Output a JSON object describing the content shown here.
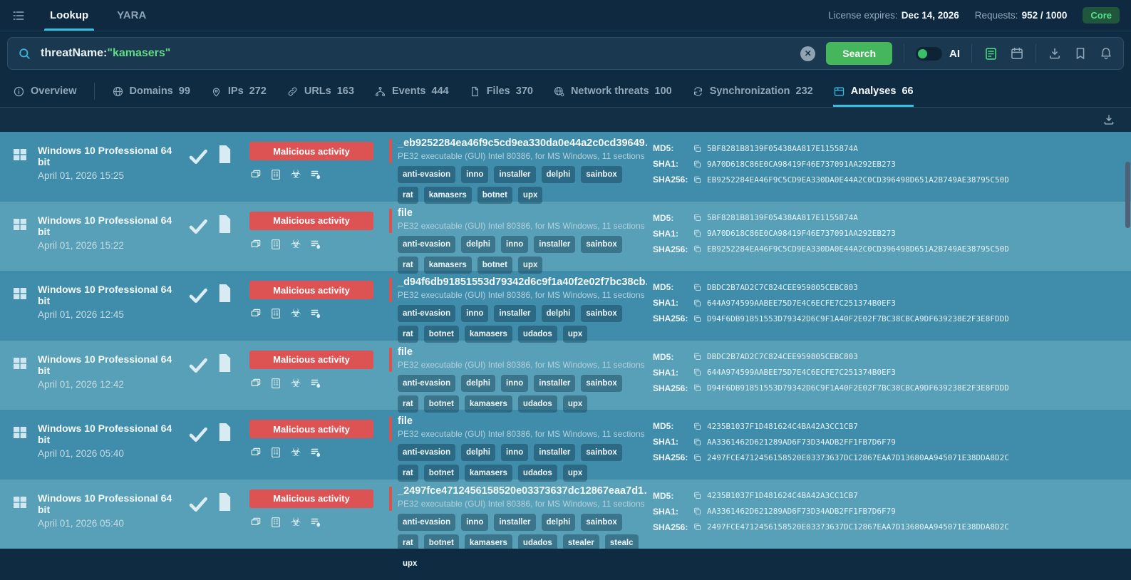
{
  "topbar": {
    "nav_tabs": [
      {
        "label": "Lookup",
        "active": true
      },
      {
        "label": "YARA",
        "active": false
      }
    ],
    "license_label": "License expires:",
    "license_value": "Dec 14, 2026",
    "requests_label": "Requests:",
    "requests_value": "952 / 1000",
    "plan_badge": "Core",
    "menu_icon": "list-icon"
  },
  "search": {
    "icon": "search-icon",
    "query_prefix": "threatName:",
    "query_value": "\"kamasers\"",
    "clear_icon": "close-icon",
    "search_button": "Search",
    "ai_toggle_on": true,
    "ai_label": "AI",
    "tool_icons": [
      "doc-lines-icon",
      "calendar-icon",
      "download-icon",
      "bookmark-icon",
      "bell-icon"
    ]
  },
  "result_tabs": [
    {
      "label": "Overview",
      "count": "",
      "icon": "info-icon",
      "active": false,
      "divider_after": true
    },
    {
      "label": "Domains",
      "count": "99",
      "icon": "globe-icon",
      "active": false
    },
    {
      "label": "IPs",
      "count": "272",
      "icon": "pin-icon",
      "active": false
    },
    {
      "label": "URLs",
      "count": "163",
      "icon": "link-icon",
      "active": false
    },
    {
      "label": "Events",
      "count": "444",
      "icon": "branch-icon",
      "active": false
    },
    {
      "label": "Files",
      "count": "370",
      "icon": "file-icon",
      "active": false
    },
    {
      "label": "Network threats",
      "count": "100",
      "icon": "globe-gear-icon",
      "active": false
    },
    {
      "label": "Synchronization",
      "count": "232",
      "icon": "sync-icon",
      "active": false
    },
    {
      "label": "Analyses",
      "count": "66",
      "icon": "browser-icon",
      "active": true
    }
  ],
  "results_header": {
    "download_icon": "download-icon"
  },
  "row_action_icons": [
    "stacked-windows-icon",
    "report-icon",
    "biohazard-icon",
    "threat-list-icon"
  ],
  "rows": [
    {
      "os": "Windows 10 Professional 64 bit",
      "date": "April 01, 2026 15:25",
      "verdict": "Malicious activity",
      "name": "_eb9252284ea46f9c5cd9ea330da0e44a2c0cd39649…",
      "file_type": "PE32 executable (GUI) Intel 80386, for MS Windows, 11 sections",
      "tags": [
        "anti-evasion",
        "inno",
        "installer",
        "delphi",
        "sainbox",
        "rat",
        "kamasers",
        "botnet",
        "upx"
      ],
      "hashes": [
        {
          "label": "MD5:",
          "value": "5BF8281B8139F05438AA817E1155874A"
        },
        {
          "label": "SHA1:",
          "value": "9A70D618C86E0CA98419F46E737091AA292EB273"
        },
        {
          "label": "SHA256:",
          "value": "EB9252284EA46F9C5CD9EA330DA0E44A2C0CD396498D651A2B749AE38795C50D"
        }
      ]
    },
    {
      "os": "Windows 10 Professional 64 bit",
      "date": "April 01, 2026 15:22",
      "verdict": "Malicious activity",
      "name": "file",
      "file_type": "PE32 executable (GUI) Intel 80386, for MS Windows, 11 sections",
      "tags": [
        "anti-evasion",
        "delphi",
        "inno",
        "installer",
        "sainbox",
        "rat",
        "kamasers",
        "botnet",
        "upx"
      ],
      "hashes": [
        {
          "label": "MD5:",
          "value": "5BF8281B8139F05438AA817E1155874A"
        },
        {
          "label": "SHA1:",
          "value": "9A70D618C86E0CA98419F46E737091AA292EB273"
        },
        {
          "label": "SHA256:",
          "value": "EB9252284EA46F9C5CD9EA330DA0E44A2C0CD396498D651A2B749AE38795C50D"
        }
      ]
    },
    {
      "os": "Windows 10 Professional 64 bit",
      "date": "April 01, 2026 12:45",
      "verdict": "Malicious activity",
      "name": "_d94f6db91851553d79342d6c9f1a40f2e02f7bc38cb…",
      "file_type": "PE32 executable (GUI) Intel 80386, for MS Windows, 11 sections",
      "tags": [
        "anti-evasion",
        "inno",
        "installer",
        "delphi",
        "sainbox",
        "rat",
        "botnet",
        "kamasers",
        "udados",
        "upx"
      ],
      "hashes": [
        {
          "label": "MD5:",
          "value": "DBDC2B7AD2C7C824CEE959805CEBC803"
        },
        {
          "label": "SHA1:",
          "value": "644A974599AABEE75D7E4C6ECFE7C251374B0EF3"
        },
        {
          "label": "SHA256:",
          "value": "D94F6DB91851553D79342D6C9F1A40F2E02F7BC38CBCA9DF639238E2F3E8FDDD"
        }
      ]
    },
    {
      "os": "Windows 10 Professional 64 bit",
      "date": "April 01, 2026 12:42",
      "verdict": "Malicious activity",
      "name": "file",
      "file_type": "PE32 executable (GUI) Intel 80386, for MS Windows, 11 sections",
      "tags": [
        "anti-evasion",
        "delphi",
        "inno",
        "installer",
        "sainbox",
        "rat",
        "botnet",
        "kamasers",
        "udados",
        "upx"
      ],
      "hashes": [
        {
          "label": "MD5:",
          "value": "DBDC2B7AD2C7C824CEE959805CEBC803"
        },
        {
          "label": "SHA1:",
          "value": "644A974599AABEE75D7E4C6ECFE7C251374B0EF3"
        },
        {
          "label": "SHA256:",
          "value": "D94F6DB91851553D79342D6C9F1A40F2E02F7BC38CBCA9DF639238E2F3E8FDDD"
        }
      ]
    },
    {
      "os": "Windows 10 Professional 64 bit",
      "date": "April 01, 2026 05:40",
      "verdict": "Malicious activity",
      "name": "file",
      "file_type": "PE32 executable (GUI) Intel 80386, for MS Windows, 11 sections",
      "tags": [
        "anti-evasion",
        "delphi",
        "inno",
        "installer",
        "sainbox",
        "rat",
        "botnet",
        "kamasers",
        "udados",
        "upx"
      ],
      "hashes": [
        {
          "label": "MD5:",
          "value": "4235B1037F1D481624C4BA42A3CC1CB7"
        },
        {
          "label": "SHA1:",
          "value": "AA3361462D621289AD6F73D34ADB2FF1FB7D6F79"
        },
        {
          "label": "SHA256:",
          "value": "2497FCE4712456158520E03373637DC12867EAA7D13680AA945071E38DDA8D2C"
        }
      ]
    },
    {
      "os": "Windows 10 Professional 64 bit",
      "date": "April 01, 2026 05:40",
      "verdict": "Malicious activity",
      "name": "_2497fce4712456158520e03373637dc12867eaa7d1…",
      "file_type": "PE32 executable (GUI) Intel 80386, for MS Windows, 11 sections",
      "tags": [
        "anti-evasion",
        "inno",
        "installer",
        "delphi",
        "sainbox",
        "rat",
        "botnet",
        "kamasers",
        "udados",
        "stealer",
        "stealc",
        "upx"
      ],
      "hashes": [
        {
          "label": "MD5:",
          "value": "4235B1037F1D481624C4BA42A3CC1CB7"
        },
        {
          "label": "SHA1:",
          "value": "AA3361462D621289AD6F73D34ADB2FF1FB7D6F79"
        },
        {
          "label": "SHA256:",
          "value": "2497FCE4712456158520E03373637DC12867EAA7D13680AA945071E38DDA8D2C"
        }
      ]
    }
  ],
  "colors": {
    "accent_cyan": "#38bedf",
    "accent_green": "#46b65c",
    "query_green": "#63da85",
    "verdict_red": "#dd5252",
    "row_dark": "#3f8daa",
    "row_light": "#57a0b7",
    "topbar_bg": "#0e2940"
  }
}
